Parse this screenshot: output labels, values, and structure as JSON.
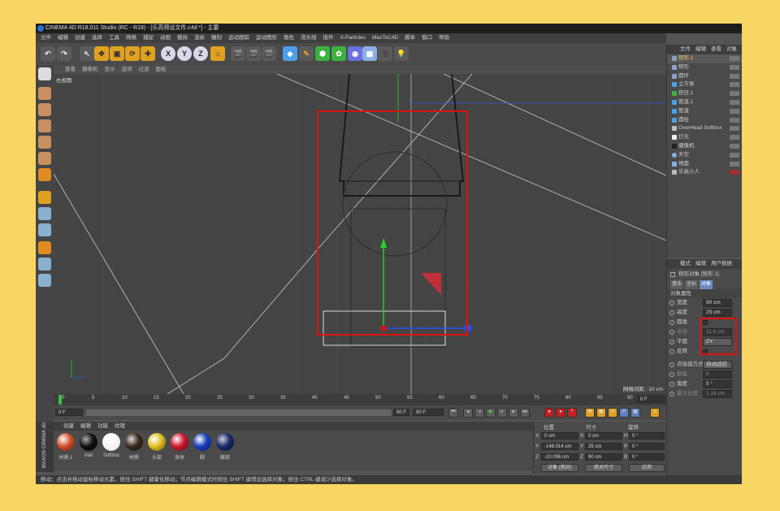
{
  "window": {
    "title": "CINEMA 4D R18.011 Studio (RC - R18) - [乐高预设文件.c4d *] - 主要"
  },
  "menu": [
    "文件",
    "编辑",
    "创建",
    "选择",
    "工具",
    "网格",
    "捕捉",
    "动画",
    "模拟",
    "渲染",
    "雕刻",
    "运动跟踪",
    "运动图形",
    "角色",
    "流水线",
    "插件",
    "X-Particles",
    "MaxToC4D",
    "脚本",
    "窗口",
    "帮助"
  ],
  "toolbar": {
    "icons": [
      "undo-icon",
      "live-select-icon",
      "move-icon",
      "scale-icon",
      "rotate-icon",
      "add-icon",
      "x-axis-icon",
      "y-axis-icon",
      "z-axis-icon",
      "world-coord-icon",
      "render-view-icon",
      "render-picture-icon",
      "render-settings-icon",
      "cube-icon",
      "pen-icon",
      "subdivision-icon",
      "array-icon",
      "deformer-icon",
      "floor-icon",
      "camera-icon",
      "light-icon"
    ],
    "axis_labels": [
      "X",
      "Y",
      "Z"
    ]
  },
  "viewport": {
    "menu": [
      "查看",
      "摄像机",
      "显示",
      "选项",
      "过滤",
      "面板"
    ],
    "view_name": "右视图",
    "grid_spacing": "网格间距 : 10 cm"
  },
  "timeline": {
    "ticks": [
      "0",
      "5",
      "10",
      "15",
      "20",
      "25",
      "30",
      "35",
      "40",
      "45",
      "50",
      "55",
      "60",
      "65",
      "70",
      "75",
      "80",
      "85",
      "90"
    ],
    "current_frame": "0 F",
    "start_frame": "0 F",
    "range_end": "90 F",
    "end_frame": "90 F"
  },
  "materials": {
    "tabs": [
      "创建",
      "编辑",
      "功能",
      "纹理"
    ],
    "items": [
      {
        "label": "材质.1",
        "color": "#d0502a"
      },
      {
        "label": "Mat",
        "color": "#111111"
      },
      {
        "label": "Softbox",
        "color": "#f4f4f4"
      },
      {
        "label": "材质",
        "color": "#3a2a1a"
      },
      {
        "label": "头部",
        "color": "#e0c020"
      },
      {
        "label": "身体",
        "color": "#d01830"
      },
      {
        "label": "脚",
        "color": "#1840c0"
      },
      {
        "label": "腰部",
        "color": "#1a2a6a"
      }
    ],
    "brand": "MAXON CINEMA 4D"
  },
  "coords": {
    "headers": [
      "位置",
      "尺寸",
      "旋转"
    ],
    "rows": [
      {
        "axis": "X",
        "pos": "0 cm",
        "size_axis": "X",
        "size": "0 cm",
        "rot_axis": "H",
        "rot": "0 °"
      },
      {
        "axis": "Y",
        "pos": "-148.014 cm",
        "size_axis": "Y",
        "size": "25 cm",
        "rot_axis": "P",
        "rot": "0 °"
      },
      {
        "axis": "Z",
        "pos": "-10.096 cm",
        "size_axis": "Z",
        "size": "90 cm",
        "rot_axis": "B",
        "rot": "0 °"
      }
    ],
    "mode": "对象 (相对)",
    "size_mode": "绝对尺寸",
    "apply": "应用"
  },
  "objects": {
    "tabs": [
      "文件",
      "编辑",
      "查看",
      "对象"
    ],
    "items": [
      {
        "label": "矩形.1",
        "color": "#e0c060"
      },
      {
        "label": "矩形",
        "color": "#cfcfcf"
      },
      {
        "label": "圆环",
        "color": "#cfcfcf"
      },
      {
        "label": "立方体",
        "color": "#cfcfcf"
      },
      {
        "label": "挤压.1",
        "color": "#cfcfcf"
      },
      {
        "label": "管道.1",
        "color": "#cfcfcf"
      },
      {
        "label": "管道",
        "color": "#cfcfcf"
      },
      {
        "label": "圆柱",
        "color": "#cfcfcf"
      },
      {
        "label": "OverHead Softbox",
        "color": "#cfcfcf"
      },
      {
        "label": "灯光",
        "color": "#cfcfcf"
      },
      {
        "label": "摄像机",
        "color": "#cfcfcf"
      },
      {
        "label": "天空",
        "color": "#cfcfcf"
      },
      {
        "label": "地面",
        "color": "#cfcfcf"
      },
      {
        "label": "乐高小人",
        "color": "#cfcfcf"
      }
    ]
  },
  "attributes": {
    "tabs": [
      "模式",
      "编辑",
      "用户数据"
    ],
    "object_title": "矩形对象 [矩形.1]",
    "subtabs": [
      "基本",
      "坐标",
      "对象"
    ],
    "section": "对象属性",
    "fields": [
      {
        "label": "宽度",
        "value": "90 cm"
      },
      {
        "label": "高度",
        "value": "25 cm"
      },
      {
        "label": "圆角",
        "value": ""
      },
      {
        "label": "半径",
        "value": "11.4 cm"
      },
      {
        "label": "平面",
        "value": "ZY"
      },
      {
        "label": "反转",
        "value": ""
      },
      {
        "label": "点插值方式",
        "value": "自动适应"
      },
      {
        "label": "数量",
        "value": "8"
      },
      {
        "label": "角度",
        "value": "5 °"
      },
      {
        "label": "最大长度",
        "value": "1.14 cm"
      }
    ]
  },
  "status": "移动：点击并拖动鼠标移动元素。按住 SHIFT 键量化移动；节点编辑模式时按住 SHIFT 键增加选择对象；按住 CTRL 键减少选择对象。"
}
